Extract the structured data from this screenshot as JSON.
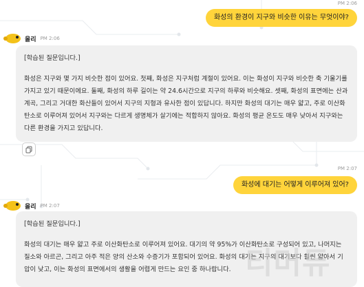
{
  "messages": {
    "user1": {
      "time": "PM 2:06",
      "text": "화성의 환경이 지구와 비슷한 이유는 무엇이야?"
    },
    "bot1": {
      "name": "올리",
      "time": "PM 2:06",
      "tag": "[학습된 질문입니다.]",
      "body": "화성은 지구와 몇 가지 비슷한 점이 있어요. 첫째, 화성은 지구처럼 계절이 있어요. 이는 화성이 지구와 비슷한 축 기울기를 가지고 있기 때문이에요. 둘째, 화성의 하루 길이는 약 24.6시간으로 지구의 하루와 비슷해요. 셋째, 화성의 표면에는 산과 계곡, 그리고 거대한 화산들이 있어서 지구의 지형과 유사한 점이 있답니다. 하지만 화성의 대기는 매우 얇고, 주로 이산화탄소로 이루어져 있어서 지구와는 다르게 생명체가 살기에는 적합하지 않아요. 화성의 평균 온도도 매우 낮아서 지구와는 다른 환경을 가지고 있답니다."
    },
    "user2": {
      "time": "PM 2:07",
      "text": "화성에 대기는 어떻게 이루어져 있어?"
    },
    "bot2": {
      "name": "올리",
      "time": "PM 2:07",
      "tag": "[학습된 질문입니다.]",
      "body": "화성의 대기는 매우 얇고 주로 이산화탄소로 이루어져 있어요. 대기의 약 95%가 이산화탄소로 구성되어 있고, 나머지는 질소와 아르곤, 그리고 아주 적은 양의 산소와 수증기가 포함되어 있어요. 화성의 대기는 지구의 대기보다 훨씬 얇아서 기압이 낮고, 이는 화성의 표면에서의 생활을 어렵게 만드는 요인 중 하나랍니다."
    }
  },
  "watermark": "티머듀",
  "icons": {
    "avatar": "bird-mascot-icon",
    "copy": "copy-icon"
  },
  "colors": {
    "user_bubble": "#ffd43b",
    "bot_bubble": "#f0f0f0",
    "background": "#ffffff"
  }
}
